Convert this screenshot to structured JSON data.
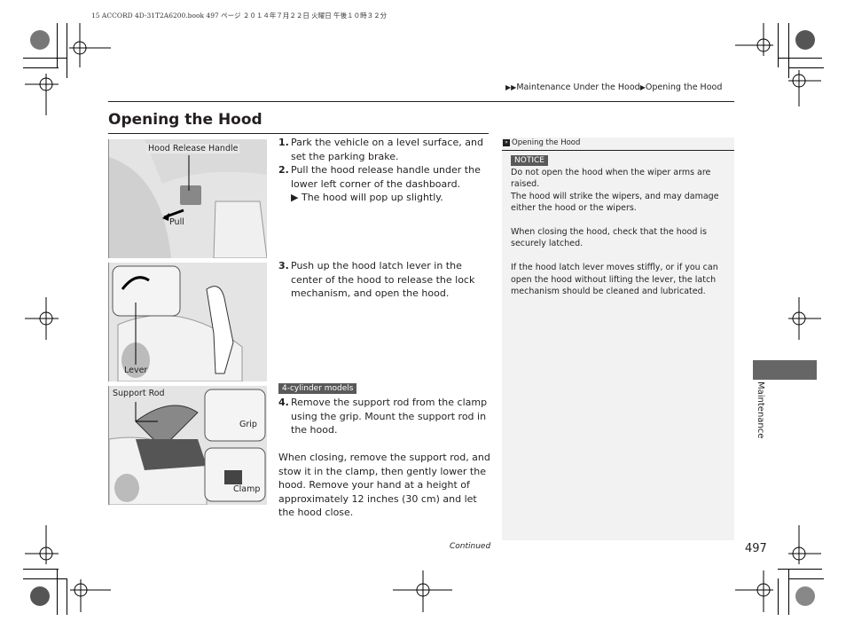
{
  "print_header": "15 ACCORD 4D-31T2A6200.book  497 ページ  ２０１４年７月２２日  火曜日  午後１０時３２分",
  "breadcrumb": {
    "items": [
      "Maintenance Under the Hood",
      "Opening the Hood"
    ]
  },
  "page_title": "Opening the Hood",
  "figures": [
    {
      "labels": [
        "Hood Release Handle",
        "Pull"
      ]
    },
    {
      "labels": [
        "Lever"
      ]
    },
    {
      "labels": [
        "Support Rod",
        "Grip",
        "Clamp"
      ]
    }
  ],
  "steps": [
    {
      "num": "1.",
      "text": "Park the vehicle on a level surface, and set the parking brake."
    },
    {
      "num": "2.",
      "text": "Pull the hood release handle under the lower left corner of the dashboard.",
      "result": "The hood will pop up slightly."
    },
    {
      "num": "3.",
      "text": "Push up the hood latch lever in the center of the hood to release the lock mechanism, and open the hood."
    },
    {
      "num": "4.",
      "text": "Remove the support rod from the clamp using the grip. Mount the support rod in the hood."
    }
  ],
  "model_badge": "4-cylinder models",
  "closing_paragraph": "When closing, remove the support rod, and stow it in the clamp, then gently lower the hood. Remove your hand at a height of approximately 12 inches (30 cm) and let the hood close.",
  "continued": "Continued",
  "side_panel": {
    "heading": "Opening the Hood",
    "notice_label": "NOTICE",
    "paragraphs": [
      "Do not open the hood when the wiper arms are raised.\nThe hood will strike the wipers, and may damage either the hood or the wipers.",
      "When closing the hood, check that the hood is securely latched.",
      "If the hood latch lever moves stiffly, or if you can open the hood without lifting the lever, the latch mechanism should be cleaned and lubricated."
    ]
  },
  "section_tab": "Maintenance",
  "page_number": "497",
  "colors": {
    "panel_bg": "#f2f2f2",
    "badge_bg": "#595959",
    "tab_bg": "#666666",
    "text": "#231f20"
  }
}
